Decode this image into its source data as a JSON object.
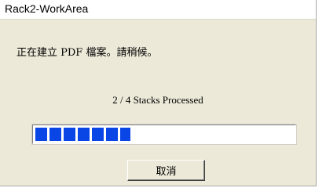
{
  "window": {
    "title": "Rack2-WorkArea"
  },
  "dialog": {
    "message": "正在建立 PDF 檔案。請稍候。",
    "status": "2 / 4 Stacks Processed",
    "progress": {
      "value": 0.37,
      "color": "#0a46e6"
    },
    "cancel_label": "取消"
  }
}
